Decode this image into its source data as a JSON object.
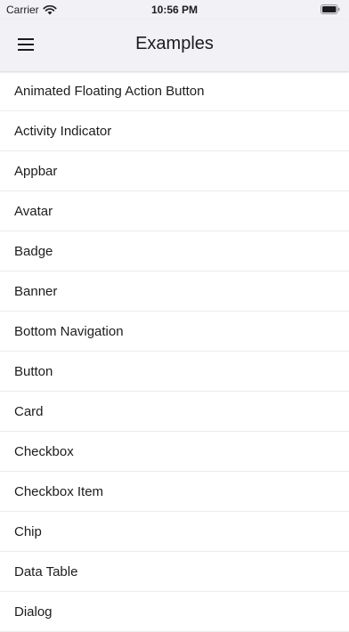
{
  "status_bar": {
    "carrier": "Carrier",
    "time": "10:56 PM",
    "icons": [
      "wifi-icon",
      "battery-icon"
    ]
  },
  "appbar": {
    "title": "Examples",
    "menu_icon": "menu-icon"
  },
  "examples": [
    "Animated Floating Action Button",
    "Activity Indicator",
    "Appbar",
    "Avatar",
    "Badge",
    "Banner",
    "Bottom Navigation",
    "Button",
    "Card",
    "Checkbox",
    "Checkbox Item",
    "Chip",
    "Data Table",
    "Dialog"
  ],
  "colors": {
    "bar_background": "#f2f1f6",
    "text": "#1c1c1e",
    "divider": "#ececec"
  }
}
